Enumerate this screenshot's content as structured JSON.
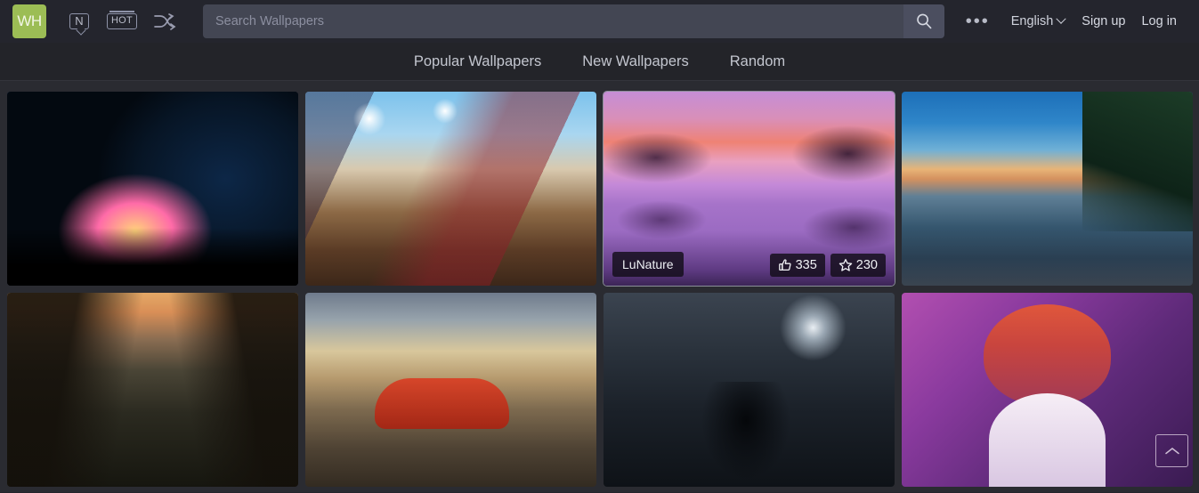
{
  "header": {
    "logo_text": "WH",
    "logo_color": "#9cbd55",
    "icons": [
      {
        "name": "new-icon",
        "label": "N"
      },
      {
        "name": "hot-icon",
        "label": "HOT"
      },
      {
        "name": "shuffle-icon",
        "label": "shuffle"
      }
    ],
    "search": {
      "placeholder": "Search Wallpapers",
      "value": "",
      "button_icon": "search-icon"
    },
    "more_label": "•••",
    "language": "English",
    "sign_up": "Sign up",
    "log_in": "Log in"
  },
  "nav": {
    "items": [
      {
        "label": "Popular Wallpapers"
      },
      {
        "label": "New Wallpapers"
      },
      {
        "label": "Random"
      }
    ]
  },
  "grid": {
    "rows": [
      [
        {
          "art": "t-space",
          "alt": "space-nebula-planet",
          "hovered": false
        },
        {
          "art": "t-anime",
          "alt": "anime-village-scene",
          "hovered": false
        },
        {
          "art": "t-lunature",
          "alt": "purple-sunset-lake",
          "hovered": true,
          "tag": "LuNature",
          "likes": "335",
          "favorites": "230"
        },
        {
          "art": "t-lake",
          "alt": "blue-lake-shore",
          "hovered": false
        }
      ],
      [
        {
          "art": "t-rail",
          "alt": "forest-railway-sunset",
          "hovered": false
        },
        {
          "art": "t-car",
          "alt": "red-car-mountains",
          "hovered": false
        },
        {
          "art": "t-dark",
          "alt": "moonlit-figure",
          "hovered": false
        },
        {
          "art": "t-anime2",
          "alt": "anime-girl-portrait",
          "hovered": false
        }
      ]
    ]
  },
  "scroll_top": {
    "icon": "chevron-up-icon",
    "title": "Scroll to top"
  }
}
